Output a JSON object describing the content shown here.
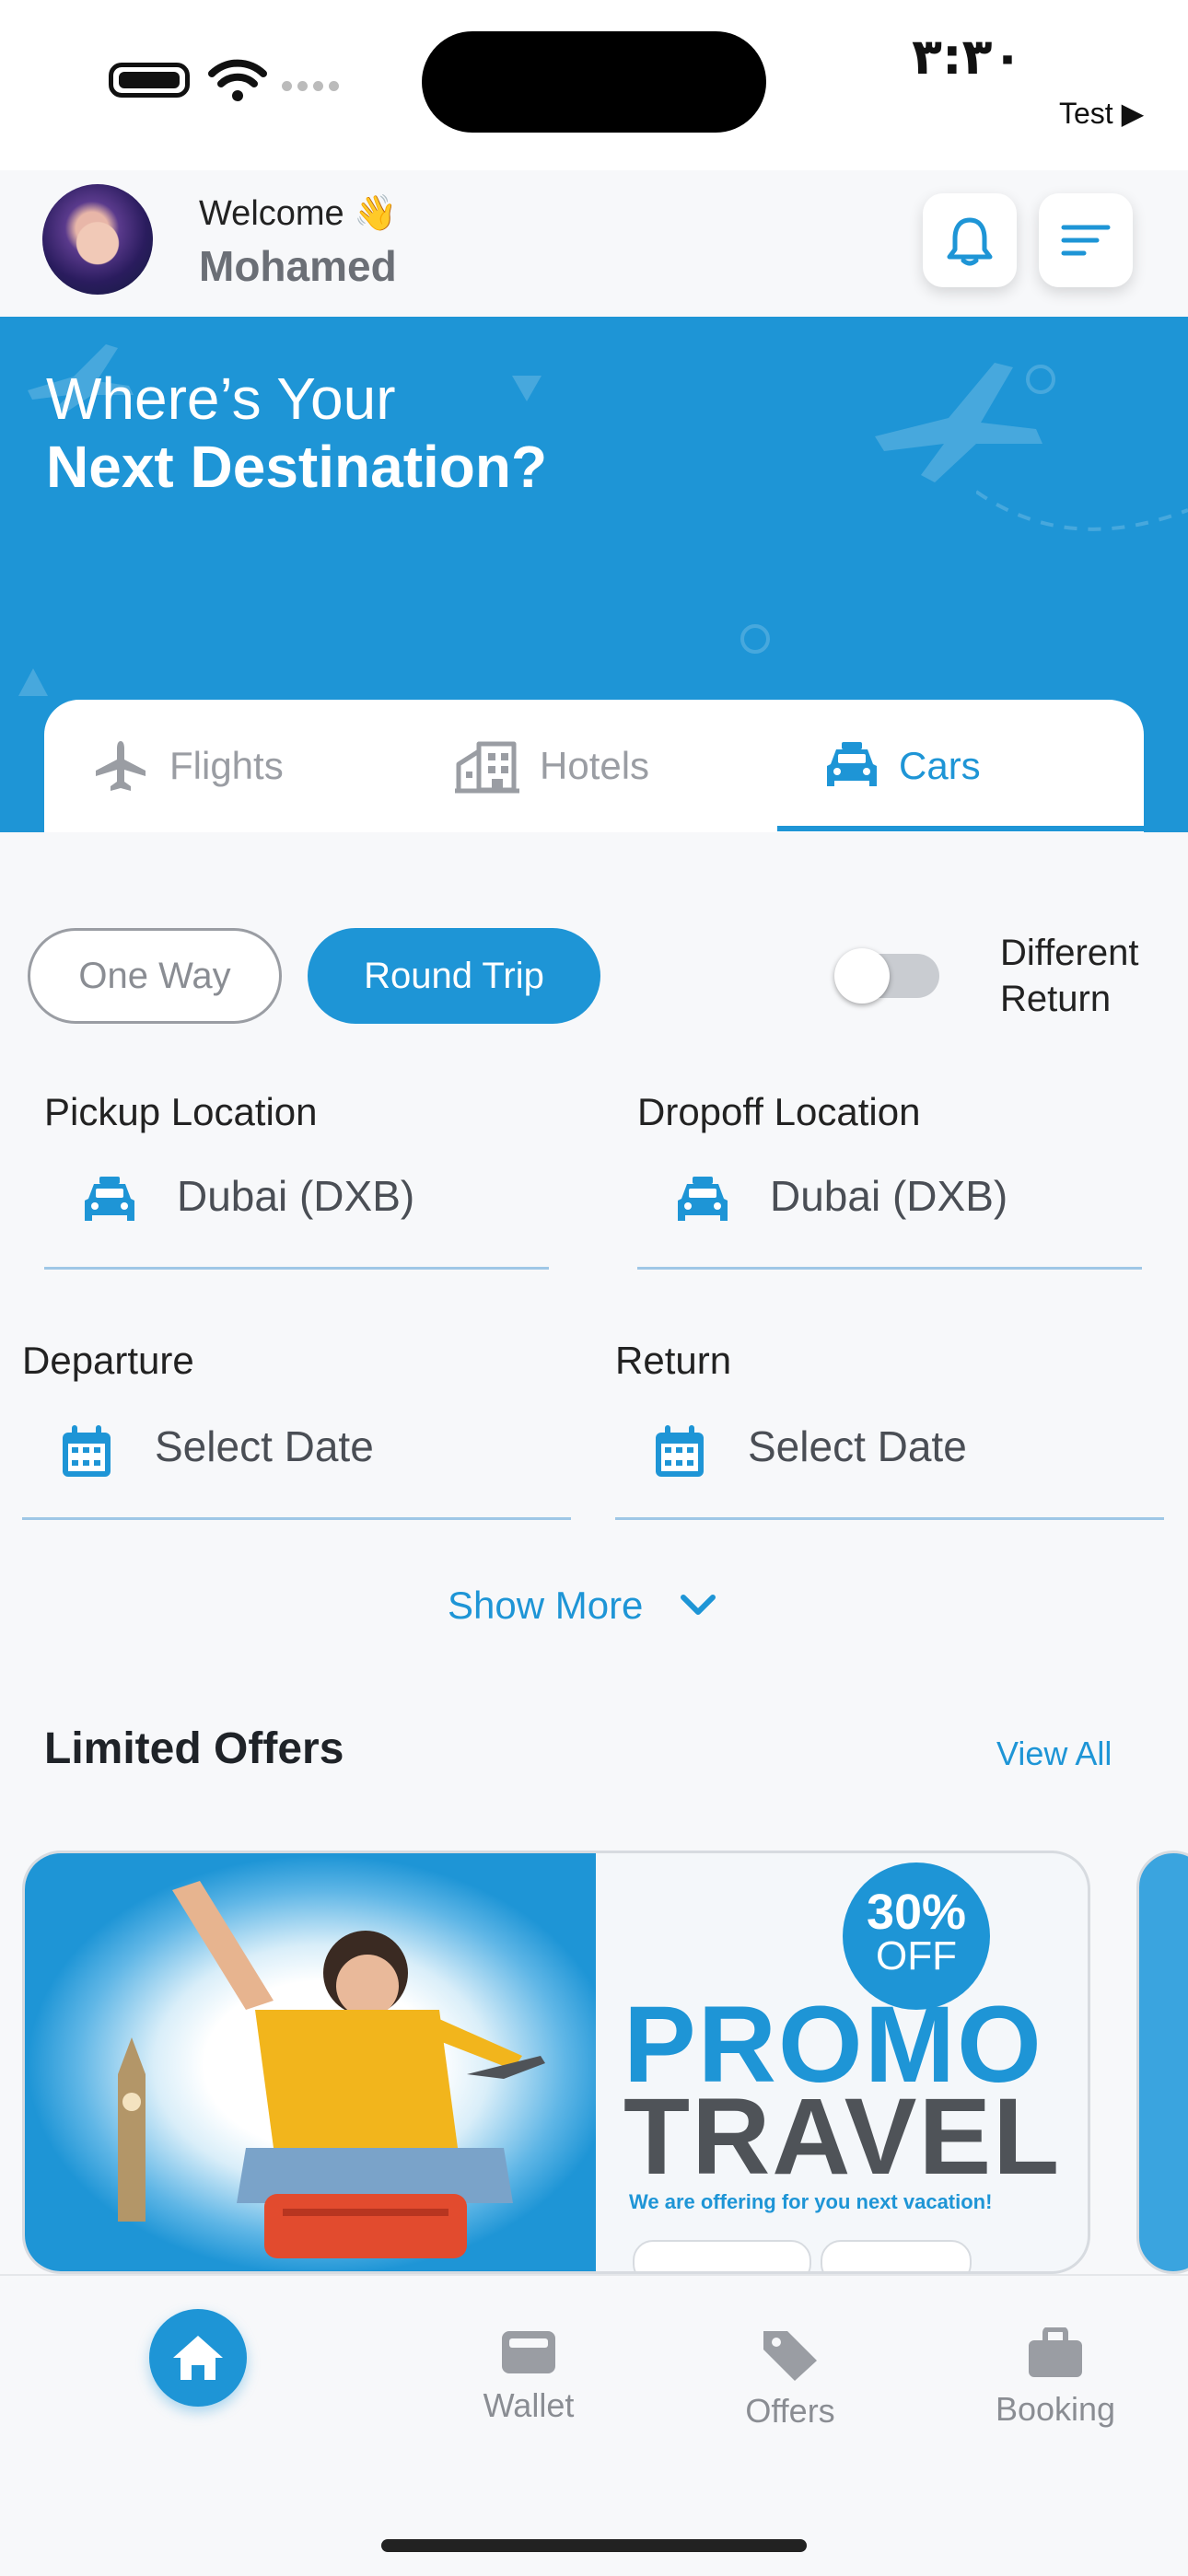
{
  "status_bar": {
    "time": "٣:٣٠",
    "carrier": "Test ▶"
  },
  "header": {
    "welcome": "Welcome 👋",
    "user_name": "Mohamed"
  },
  "hero": {
    "line1": "Where’s Your",
    "line2": "Next Destination?"
  },
  "tabs": [
    {
      "label": "Flights",
      "icon": "plane-icon",
      "active": false
    },
    {
      "label": "Hotels",
      "icon": "building-icon",
      "active": false
    },
    {
      "label": "Cars",
      "icon": "car-icon",
      "active": true
    }
  ],
  "trip_type": {
    "one_way": "One Way",
    "round_trip": "Round Trip",
    "selected": "Round Trip"
  },
  "different_return": {
    "label_line1": "Different",
    "label_line2": "Return",
    "enabled": false
  },
  "pickup": {
    "label": "Pickup Location",
    "value": "Dubai (DXB)"
  },
  "dropoff": {
    "label": "Dropoff Location",
    "value": "Dubai (DXB)"
  },
  "departure": {
    "label": "Departure",
    "value": "Select Date"
  },
  "return": {
    "label": "Return",
    "value": "Select Date"
  },
  "show_more": "Show More",
  "offers": {
    "title": "Limited Offers",
    "view_all": "View All",
    "promo": {
      "badge_percent": "30%",
      "badge_off": "OFF",
      "line1": "PROMO",
      "line2": "TRAVEL",
      "subtitle": "We are offering for you next vacation!"
    }
  },
  "bottom_nav": [
    {
      "label": "",
      "icon": "home-icon",
      "active": true
    },
    {
      "label": "Wallet",
      "icon": "wallet-icon",
      "active": false
    },
    {
      "label": "Offers",
      "icon": "tag-icon",
      "active": false
    },
    {
      "label": "Booking",
      "icon": "briefcase-icon",
      "active": false
    }
  ],
  "colors": {
    "primary": "#1e95d6",
    "muted": "#8a8d93",
    "background": "#f7f8fa"
  }
}
